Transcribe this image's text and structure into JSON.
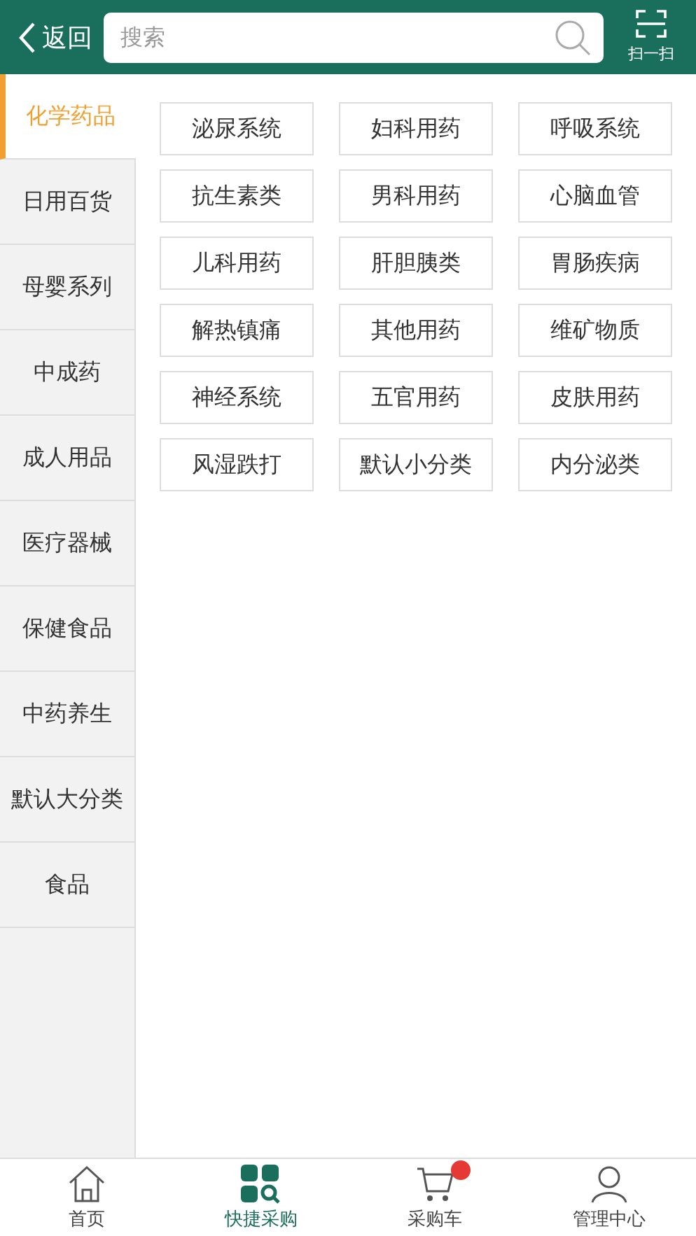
{
  "header": {
    "back_label": "返回",
    "search": {
      "placeholder": "搜索"
    },
    "scan_label": "扫一扫"
  },
  "sidebar": {
    "items": [
      {
        "label": "化学药品",
        "selected": true
      },
      {
        "label": "日用百货",
        "selected": false
      },
      {
        "label": "母婴系列",
        "selected": false
      },
      {
        "label": "中成药",
        "selected": false
      },
      {
        "label": "成人用品",
        "selected": false
      },
      {
        "label": "医疗器械",
        "selected": false
      },
      {
        "label": "保健食品",
        "selected": false
      },
      {
        "label": "中药养生",
        "selected": false
      },
      {
        "label": "默认大分类",
        "selected": false
      },
      {
        "label": "食品",
        "selected": false
      }
    ]
  },
  "subcategories": [
    "泌尿系统",
    "妇科用药",
    "呼吸系统",
    "抗生素类",
    "男科用药",
    "心脑血管",
    "儿科用药",
    "肝胆胰类",
    "胃肠疾病",
    "解热镇痛",
    "其他用药",
    "维矿物质",
    "神经系统",
    "五官用药",
    "皮肤用药",
    "风湿跌打",
    "默认小分类",
    "内分泌类"
  ],
  "tab_bar": [
    {
      "label": "首页",
      "kind": "home",
      "selected": false
    },
    {
      "label": "快捷采购",
      "kind": "quick",
      "selected": true
    },
    {
      "label": "采购车",
      "kind": "cart",
      "selected": false
    },
    {
      "label": "管理中心",
      "kind": "manage",
      "selected": false
    }
  ]
}
